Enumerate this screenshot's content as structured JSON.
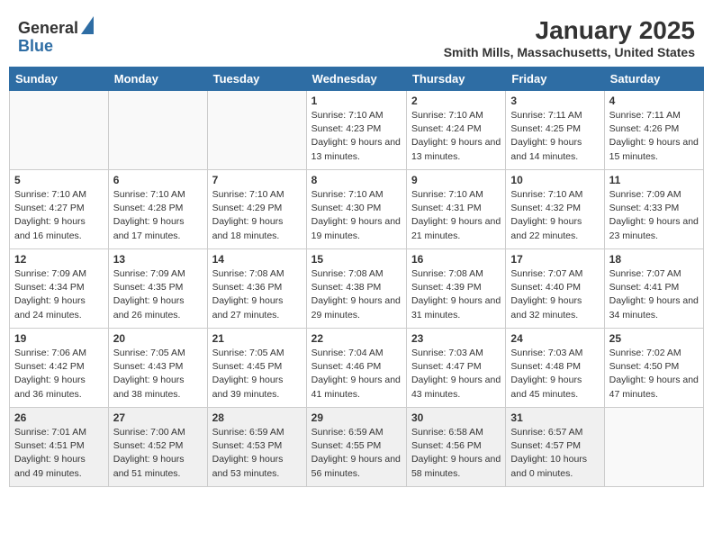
{
  "header": {
    "logo_general": "General",
    "logo_blue": "Blue",
    "month": "January 2025",
    "location": "Smith Mills, Massachusetts, United States"
  },
  "weekdays": [
    "Sunday",
    "Monday",
    "Tuesday",
    "Wednesday",
    "Thursday",
    "Friday",
    "Saturday"
  ],
  "weeks": [
    [
      {
        "day": "",
        "info": ""
      },
      {
        "day": "",
        "info": ""
      },
      {
        "day": "",
        "info": ""
      },
      {
        "day": "1",
        "info": "Sunrise: 7:10 AM\nSunset: 4:23 PM\nDaylight: 9 hours and 13 minutes."
      },
      {
        "day": "2",
        "info": "Sunrise: 7:10 AM\nSunset: 4:24 PM\nDaylight: 9 hours and 13 minutes."
      },
      {
        "day": "3",
        "info": "Sunrise: 7:11 AM\nSunset: 4:25 PM\nDaylight: 9 hours and 14 minutes."
      },
      {
        "day": "4",
        "info": "Sunrise: 7:11 AM\nSunset: 4:26 PM\nDaylight: 9 hours and 15 minutes."
      }
    ],
    [
      {
        "day": "5",
        "info": "Sunrise: 7:10 AM\nSunset: 4:27 PM\nDaylight: 9 hours and 16 minutes."
      },
      {
        "day": "6",
        "info": "Sunrise: 7:10 AM\nSunset: 4:28 PM\nDaylight: 9 hours and 17 minutes."
      },
      {
        "day": "7",
        "info": "Sunrise: 7:10 AM\nSunset: 4:29 PM\nDaylight: 9 hours and 18 minutes."
      },
      {
        "day": "8",
        "info": "Sunrise: 7:10 AM\nSunset: 4:30 PM\nDaylight: 9 hours and 19 minutes."
      },
      {
        "day": "9",
        "info": "Sunrise: 7:10 AM\nSunset: 4:31 PM\nDaylight: 9 hours and 21 minutes."
      },
      {
        "day": "10",
        "info": "Sunrise: 7:10 AM\nSunset: 4:32 PM\nDaylight: 9 hours and 22 minutes."
      },
      {
        "day": "11",
        "info": "Sunrise: 7:09 AM\nSunset: 4:33 PM\nDaylight: 9 hours and 23 minutes."
      }
    ],
    [
      {
        "day": "12",
        "info": "Sunrise: 7:09 AM\nSunset: 4:34 PM\nDaylight: 9 hours and 24 minutes."
      },
      {
        "day": "13",
        "info": "Sunrise: 7:09 AM\nSunset: 4:35 PM\nDaylight: 9 hours and 26 minutes."
      },
      {
        "day": "14",
        "info": "Sunrise: 7:08 AM\nSunset: 4:36 PM\nDaylight: 9 hours and 27 minutes."
      },
      {
        "day": "15",
        "info": "Sunrise: 7:08 AM\nSunset: 4:38 PM\nDaylight: 9 hours and 29 minutes."
      },
      {
        "day": "16",
        "info": "Sunrise: 7:08 AM\nSunset: 4:39 PM\nDaylight: 9 hours and 31 minutes."
      },
      {
        "day": "17",
        "info": "Sunrise: 7:07 AM\nSunset: 4:40 PM\nDaylight: 9 hours and 32 minutes."
      },
      {
        "day": "18",
        "info": "Sunrise: 7:07 AM\nSunset: 4:41 PM\nDaylight: 9 hours and 34 minutes."
      }
    ],
    [
      {
        "day": "19",
        "info": "Sunrise: 7:06 AM\nSunset: 4:42 PM\nDaylight: 9 hours and 36 minutes."
      },
      {
        "day": "20",
        "info": "Sunrise: 7:05 AM\nSunset: 4:43 PM\nDaylight: 9 hours and 38 minutes."
      },
      {
        "day": "21",
        "info": "Sunrise: 7:05 AM\nSunset: 4:45 PM\nDaylight: 9 hours and 39 minutes."
      },
      {
        "day": "22",
        "info": "Sunrise: 7:04 AM\nSunset: 4:46 PM\nDaylight: 9 hours and 41 minutes."
      },
      {
        "day": "23",
        "info": "Sunrise: 7:03 AM\nSunset: 4:47 PM\nDaylight: 9 hours and 43 minutes."
      },
      {
        "day": "24",
        "info": "Sunrise: 7:03 AM\nSunset: 4:48 PM\nDaylight: 9 hours and 45 minutes."
      },
      {
        "day": "25",
        "info": "Sunrise: 7:02 AM\nSunset: 4:50 PM\nDaylight: 9 hours and 47 minutes."
      }
    ],
    [
      {
        "day": "26",
        "info": "Sunrise: 7:01 AM\nSunset: 4:51 PM\nDaylight: 9 hours and 49 minutes."
      },
      {
        "day": "27",
        "info": "Sunrise: 7:00 AM\nSunset: 4:52 PM\nDaylight: 9 hours and 51 minutes."
      },
      {
        "day": "28",
        "info": "Sunrise: 6:59 AM\nSunset: 4:53 PM\nDaylight: 9 hours and 53 minutes."
      },
      {
        "day": "29",
        "info": "Sunrise: 6:59 AM\nSunset: 4:55 PM\nDaylight: 9 hours and 56 minutes."
      },
      {
        "day": "30",
        "info": "Sunrise: 6:58 AM\nSunset: 4:56 PM\nDaylight: 9 hours and 58 minutes."
      },
      {
        "day": "31",
        "info": "Sunrise: 6:57 AM\nSunset: 4:57 PM\nDaylight: 10 hours and 0 minutes."
      },
      {
        "day": "",
        "info": ""
      }
    ]
  ]
}
